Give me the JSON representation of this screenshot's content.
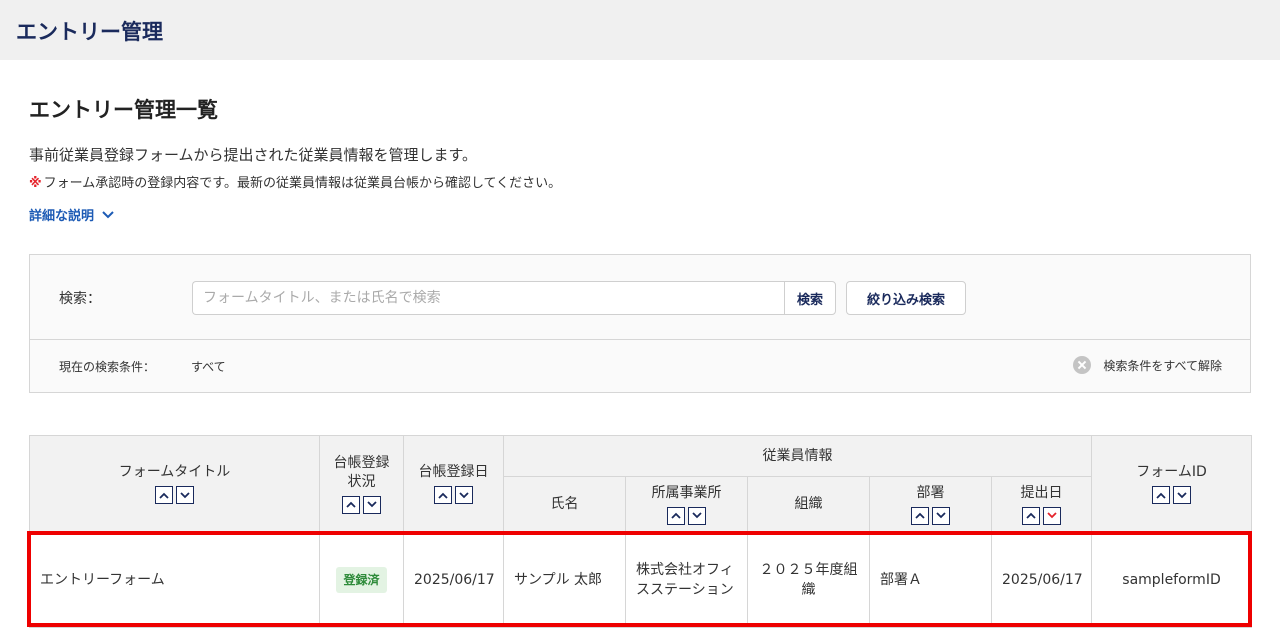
{
  "app": {
    "title": "エントリー管理"
  },
  "page": {
    "title": "エントリー管理一覧",
    "description": "事前従業員登録フォームから提出された従業員情報を管理します。",
    "note_mark": "※",
    "note": "フォーム承認時の登録内容です。最新の従業員情報は従業員台帳から確認してください。",
    "detail_link": "詳細な説明"
  },
  "search": {
    "label": "検索：",
    "placeholder": "フォームタイトル、または氏名で検索",
    "value": "",
    "search_button": "検索",
    "filter_button": "絞り込み検索",
    "condition_label": "現在の検索条件：",
    "condition_value": "すべて",
    "clear_all": "検索条件をすべて解除"
  },
  "table": {
    "headers": {
      "form_title": "フォームタイトル",
      "status_line1": "台帳登録",
      "status_line2": "状況",
      "registered_date": "台帳登録日",
      "employee_info": "従業員情報",
      "name": "氏名",
      "office": "所属事業所",
      "organization": "組織",
      "department": "部署",
      "submitted_date": "提出日",
      "form_id": "フォームID"
    },
    "rows": [
      {
        "form_title": "エントリーフォーム",
        "status": "登録済",
        "registered_date": "2025/06/17",
        "name": "サンプル 太郎",
        "office": "株式会社オフィスステーション",
        "organization": "２０２５年度組織",
        "department": "部署Ａ",
        "submitted_date": "2025/06/17",
        "form_id": "sampleformID"
      }
    ]
  },
  "colors": {
    "primary": "#1a2a5c",
    "link": "#1d5bb5",
    "accent_red": "#e5232b",
    "highlight": "#ee0000",
    "badge_bg": "#e3f3e3",
    "badge_text": "#2e8b3a"
  }
}
